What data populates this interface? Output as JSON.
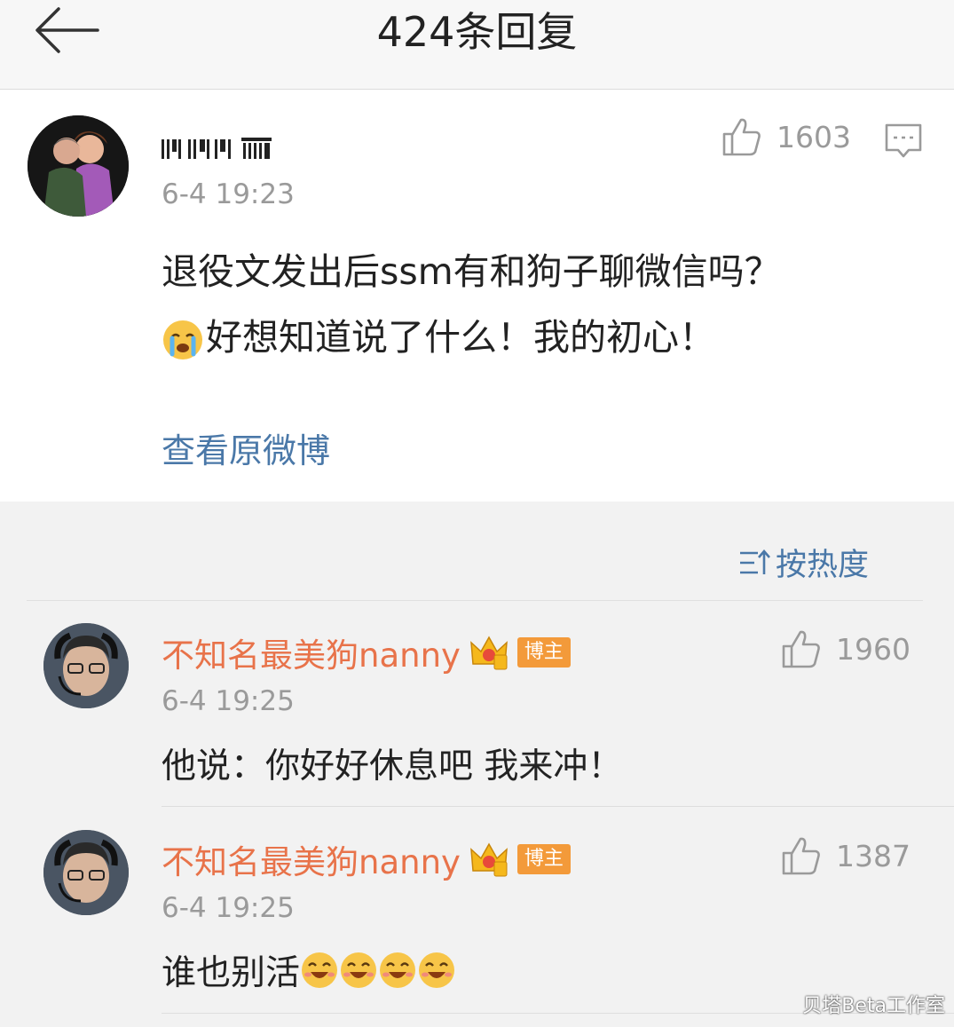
{
  "header": {
    "title": "424条回复"
  },
  "main": {
    "time": "6-4 19:23",
    "likes": "1603",
    "text_line1": "退役文发出后ssm有和狗子聊微信吗？",
    "text_line2": "好想知道说了什么！我的初心！",
    "view_original": "查看原微博"
  },
  "sort": {
    "label": "按热度"
  },
  "replies": [
    {
      "name": "不知名最美狗nanny",
      "badge": "博主",
      "time": "6-4 19:25",
      "likes": "1960",
      "text": "他说：你好好休息吧 我来冲！"
    },
    {
      "name": "不知名最美狗nanny",
      "badge": "博主",
      "time": "6-4 19:25",
      "likes": "1387",
      "text": "谁也别活"
    }
  ],
  "watermark": "贝塔Beta工作室",
  "colors": {
    "accent_name": "#e8734a",
    "link": "#4a78a8",
    "badge": "#f39a3a"
  },
  "icons": [
    "back-arrow-icon",
    "thumb-up-icon",
    "comment-icon",
    "sort-icon",
    "crown-icon",
    "crying-emoji-icon",
    "grin-emoji-icon"
  ]
}
